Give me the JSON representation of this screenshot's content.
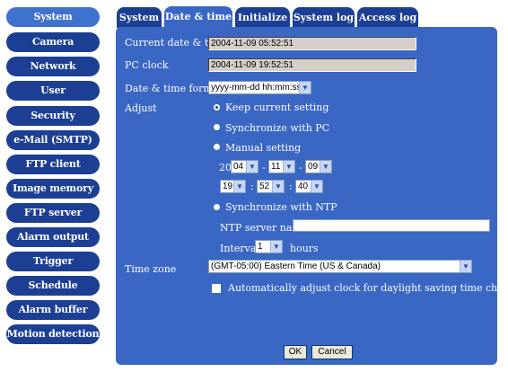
{
  "sidebar": {
    "items": [
      {
        "label": "System",
        "active": true
      },
      {
        "label": "Camera"
      },
      {
        "label": "Network"
      },
      {
        "label": "User"
      },
      {
        "label": "Security"
      },
      {
        "label": "e-Mail (SMTP)"
      },
      {
        "label": "FTP client"
      },
      {
        "label": "Image memory"
      },
      {
        "label": "FTP server"
      },
      {
        "label": "Alarm output"
      },
      {
        "label": "Trigger"
      },
      {
        "label": "Schedule"
      },
      {
        "label": "Alarm buffer"
      },
      {
        "label": "Motion detection"
      }
    ]
  },
  "tabs": [
    {
      "label": "System"
    },
    {
      "label": "Date & time",
      "active": true
    },
    {
      "label": "Initialize"
    },
    {
      "label": "System log"
    },
    {
      "label": "Access log"
    }
  ],
  "form": {
    "current_label": "Current date & time",
    "current_value": "2004-11-09  05:52:51",
    "pc_clock_label": "PC clock",
    "pc_clock_value": "2004-11-09  19:52:51",
    "format_label": "Date & time format",
    "format_value": "yyyy-mm-dd hh:mm:ss",
    "adjust_label": "Adjust",
    "keep_label": "Keep current setting",
    "sync_pc_label": "Synchronize with PC",
    "manual_label": "Manual setting",
    "year_prefix": "20",
    "year": "04",
    "month": "11",
    "day": "09",
    "hour": "19",
    "minute": "52",
    "second": "40",
    "sep_date": "-",
    "sep_time": ":",
    "sync_ntp_label": "Synchronize with NTP",
    "ntp_label": "NTP server name",
    "interval_label": "Interval",
    "interval_value": "1",
    "hours_label": "hours",
    "timezone_label": "Time zone",
    "timezone_value": "(GMT-05:00) Eastern Time (US & Canada)",
    "dst_label": "Automatically adjust clock for daylight saving time changes",
    "ok_label": "OK",
    "cancel_label": "Cancel",
    "selected_adjust": "keep"
  },
  "colors": {
    "sidebar_bg": "#1c3f94",
    "sidebar_active": "#3f72cc",
    "panel_bg": "#3a66c4"
  }
}
